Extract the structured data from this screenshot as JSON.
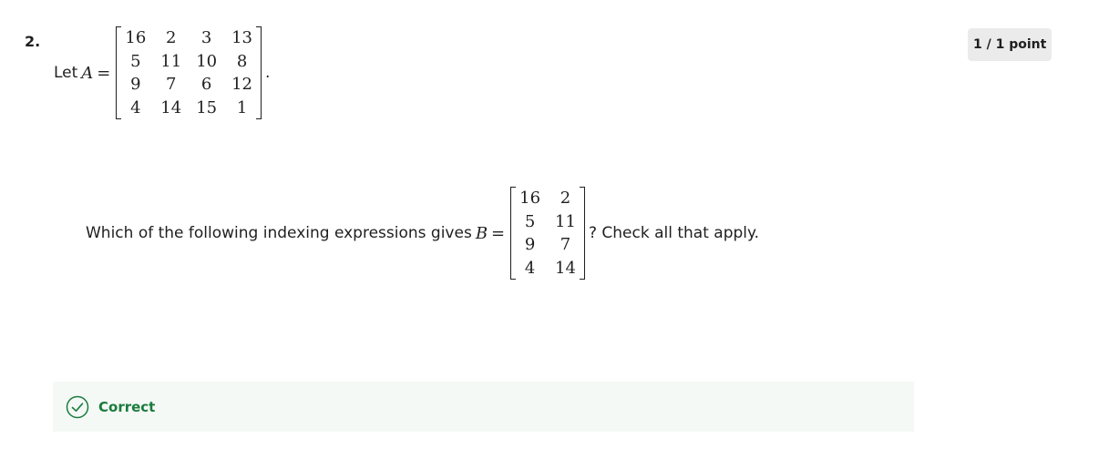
{
  "question": {
    "number": "2.",
    "points": "1 / 1 point",
    "statement": {
      "prefix": "Let",
      "variable": "A",
      "operator": "=",
      "suffix": ".",
      "matrix": [
        [
          "16",
          "2",
          "3",
          "13"
        ],
        [
          "5",
          "11",
          "10",
          "8"
        ],
        [
          "9",
          "7",
          "6",
          "12"
        ],
        [
          "4",
          "14",
          "15",
          "1"
        ]
      ]
    },
    "prompt": {
      "prefix": "Which of the following indexing expressions gives",
      "variable": "B",
      "operator": "=",
      "suffix": "? Check all that apply.",
      "matrix": [
        [
          "16",
          "2"
        ],
        [
          "5",
          "11"
        ],
        [
          "9",
          "7"
        ],
        [
          "4",
          "14"
        ]
      ]
    }
  },
  "feedback": {
    "label": "Correct",
    "icon": "check-circle-icon",
    "color": "#1b7b3d"
  }
}
